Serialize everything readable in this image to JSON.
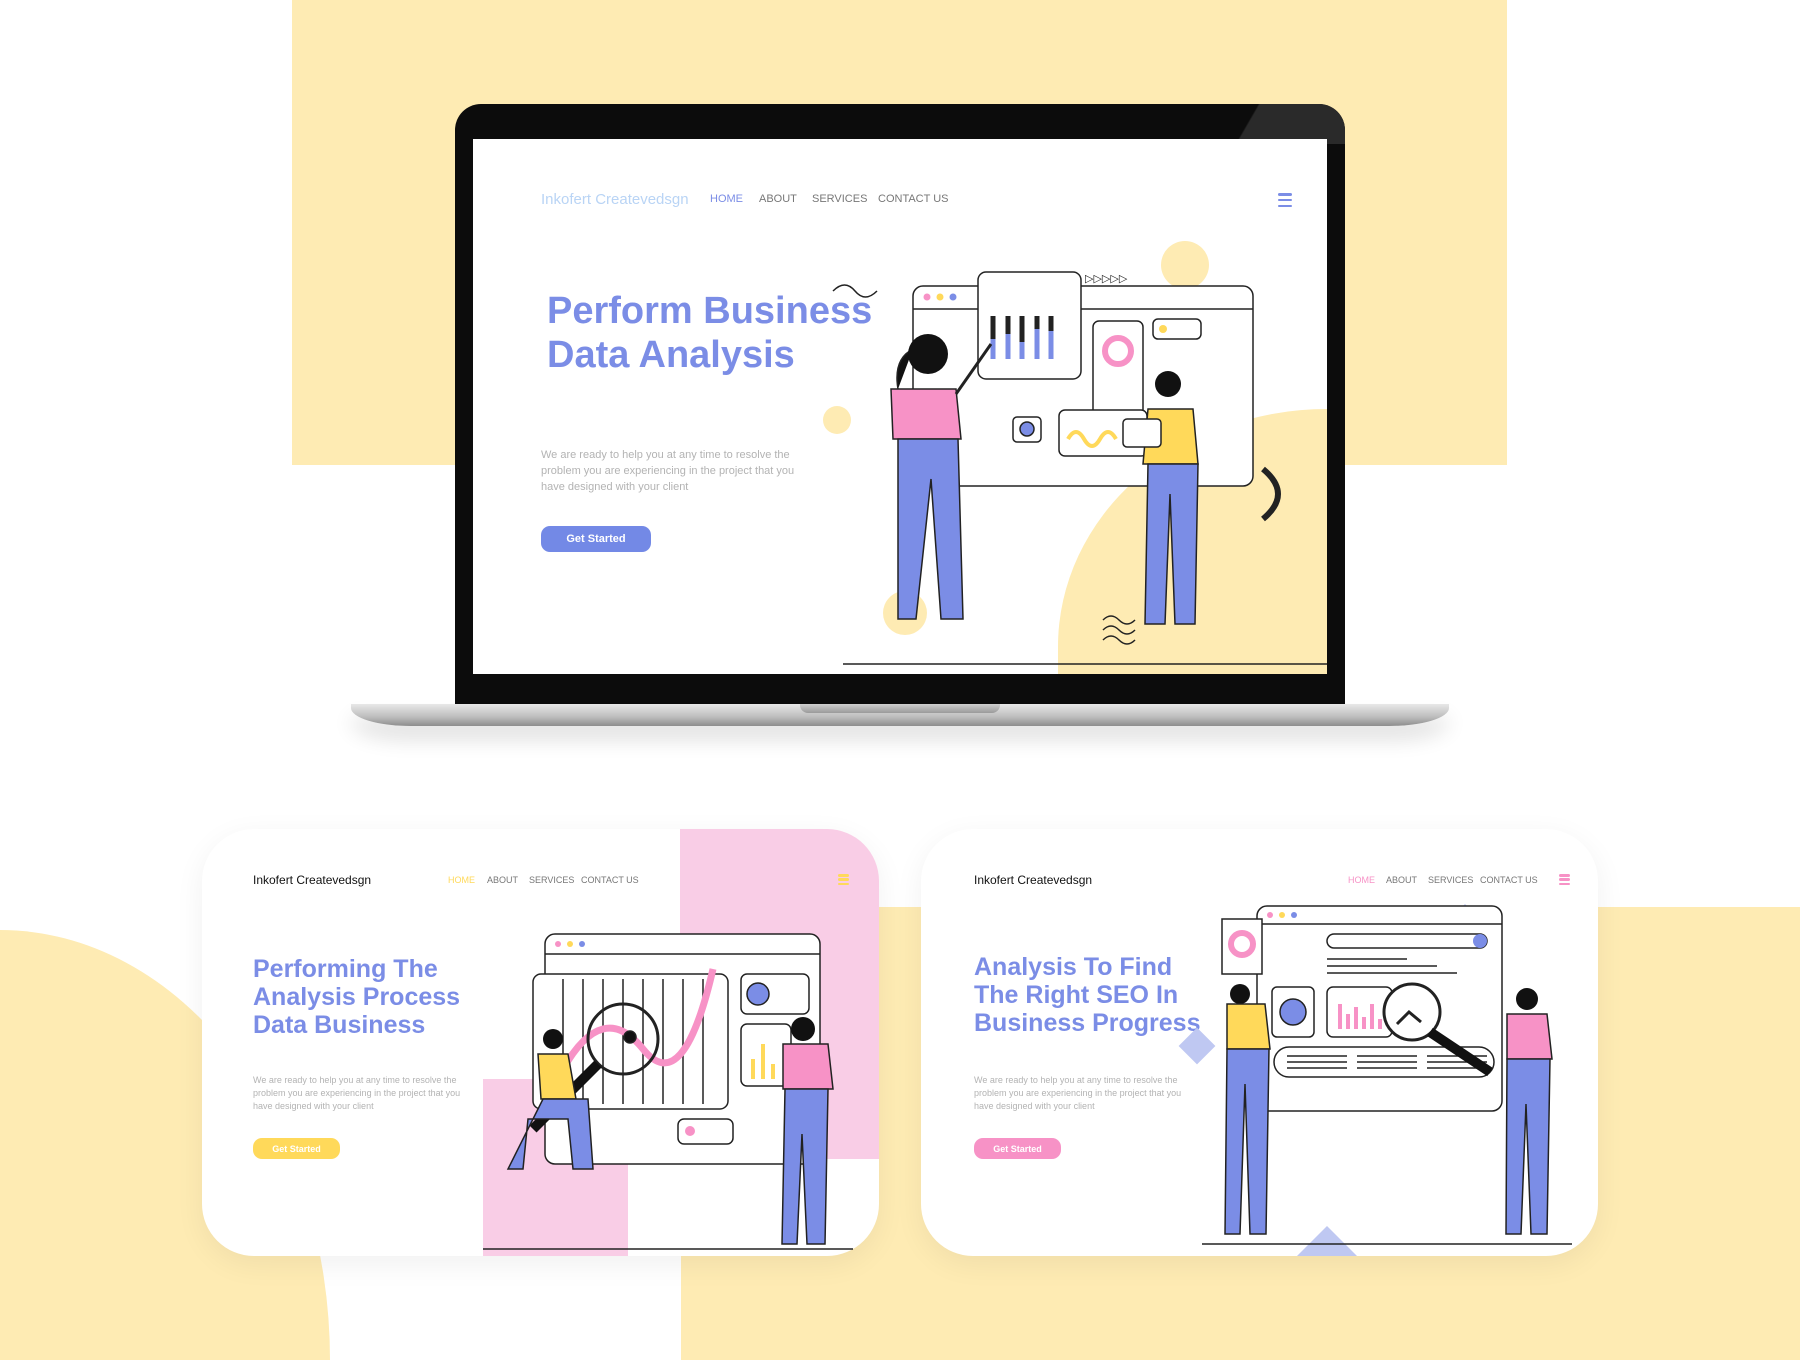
{
  "colors": {
    "yellow_bg": "#feebb3",
    "primary": "#7b8de6",
    "pink": "#f792c6",
    "yellow": "#ffd95a",
    "light_blue": "#b9d4f5"
  },
  "laptop": {
    "logo": "Inkofert Createvedsgn",
    "nav": [
      "HOME",
      "ABOUT",
      "SERVICES",
      "CONTACT US"
    ],
    "active_nav": "HOME",
    "menu_icon": "hamburger-icon",
    "headline": [
      "Perform Business",
      "Data Analysis"
    ],
    "paragraph": "We are ready to help you at any time to resolve the\nproblem you are experiencing in the project that you\nhave designed with your client",
    "cta": "Get Started"
  },
  "card1": {
    "logo": "Inkofert Createvedsgn",
    "nav": [
      "HOME",
      "ABOUT",
      "SERVICES",
      "CONTACT US"
    ],
    "headline": [
      "Performing The",
      "Analysis Process",
      "Data Business"
    ],
    "paragraph": "We are ready to help you at any time to resolve the\nproblem you are experiencing in the project that you\nhave designed with your client",
    "cta": "Get Started"
  },
  "card2": {
    "logo": "Inkofert Createvedsgn",
    "nav": [
      "HOME",
      "ABOUT",
      "SERVICES",
      "CONTACT US"
    ],
    "headline": [
      "Analysis To Find",
      "The Right SEO In",
      "Business Progress"
    ],
    "paragraph": "We are ready to help you at any time to resolve the\nproblem you are experiencing in the project that you\nhave designed with your client",
    "cta": "Get Started"
  }
}
